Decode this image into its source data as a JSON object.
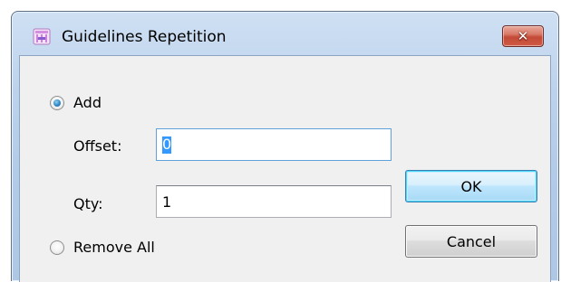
{
  "window": {
    "title": "Guidelines Repetition",
    "icon": "app-icon",
    "close_icon": "close-icon"
  },
  "options": {
    "add_label": "Add",
    "add_selected": true,
    "remove_all_label": "Remove All",
    "remove_all_selected": false
  },
  "fields": {
    "offset_label": "Offset:",
    "offset_value": "0",
    "qty_label": "Qty:",
    "qty_value": "1"
  },
  "buttons": {
    "ok_label": "OK",
    "cancel_label": "Cancel"
  },
  "colors": {
    "titlebar": "#b9d1ea",
    "client": "#f0f0f0",
    "close_button": "#c7503c",
    "default_button": "#bee6fd",
    "selection": "#3399ff"
  }
}
